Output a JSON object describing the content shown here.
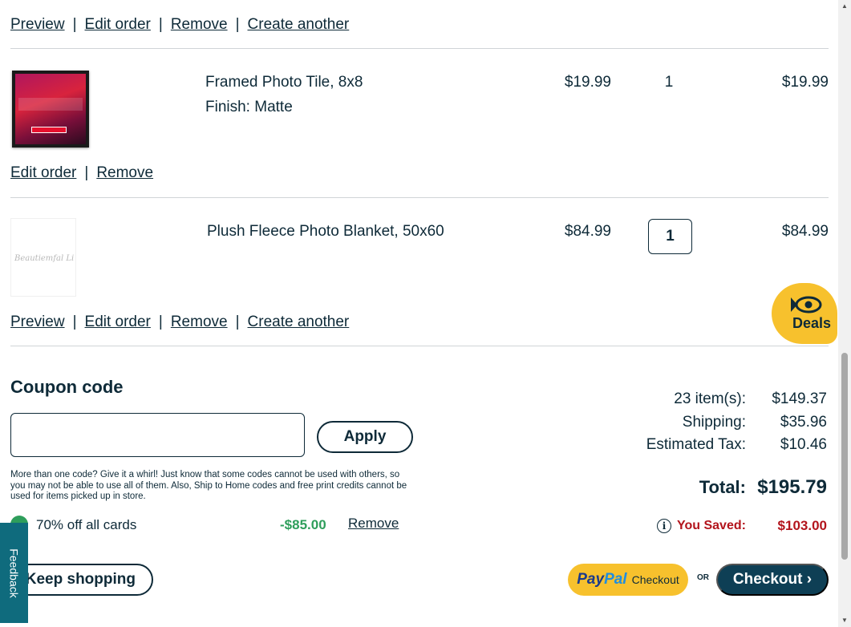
{
  "actions_top": {
    "preview": "Preview",
    "edit": "Edit order",
    "remove": "Remove",
    "create": "Create another",
    "sep": "|"
  },
  "item1": {
    "name": "Framed Photo Tile, 8x8",
    "finish": "Finish: Matte",
    "price": "$19.99",
    "qty": "1",
    "total": "$19.99"
  },
  "actions_item1": {
    "edit": "Edit order",
    "remove": "Remove",
    "sep": "|"
  },
  "item2": {
    "name": "Plush Fleece Photo Blanket, 50x60",
    "price": "$84.99",
    "qty": "1",
    "total": "$84.99",
    "thumb_text": "Beautiemfal Li"
  },
  "actions_item2": {
    "preview": "Preview",
    "edit": "Edit order",
    "remove": "Remove",
    "create": "Create another",
    "sep": "|"
  },
  "deals": {
    "label": "Deals",
    "icon": "fish-eye-icon"
  },
  "coupon": {
    "title": "Coupon code",
    "placeholder": "",
    "apply_label": "Apply",
    "note": "More than one code? Give it a whirl! Just know that some codes cannot be used with others, so you may not be able to use all of them. Also, Ship to Home codes and free print credits cannot be used for items picked up in store.",
    "applied_name": "70% off all cards",
    "applied_amount": "-$85.00",
    "applied_remove": "Remove"
  },
  "summary": {
    "items_label": "23 item(s):",
    "items_value": "$149.37",
    "shipping_label": "Shipping:",
    "shipping_value": "$35.96",
    "tax_label": "Estimated Tax:",
    "tax_value": "$10.46",
    "total_label": "Total:",
    "total_value": "$195.79",
    "saved_label": "You Saved:",
    "saved_value": "$103.00"
  },
  "footer": {
    "keep_label": "Keep shopping",
    "feedback_label": "Feedback",
    "paypal_pay": "Pay",
    "paypal_pal": "Pal",
    "paypal_checkout": "Checkout",
    "or_label": "OR",
    "checkout_label": "Checkout ›"
  },
  "colors": {
    "brand_navy": "#0e2a38",
    "deals_yellow": "#f7c12d",
    "saved_red": "#b3141c",
    "coupon_green": "#2e9e5b",
    "feedback_teal": "#0f6b7d"
  }
}
